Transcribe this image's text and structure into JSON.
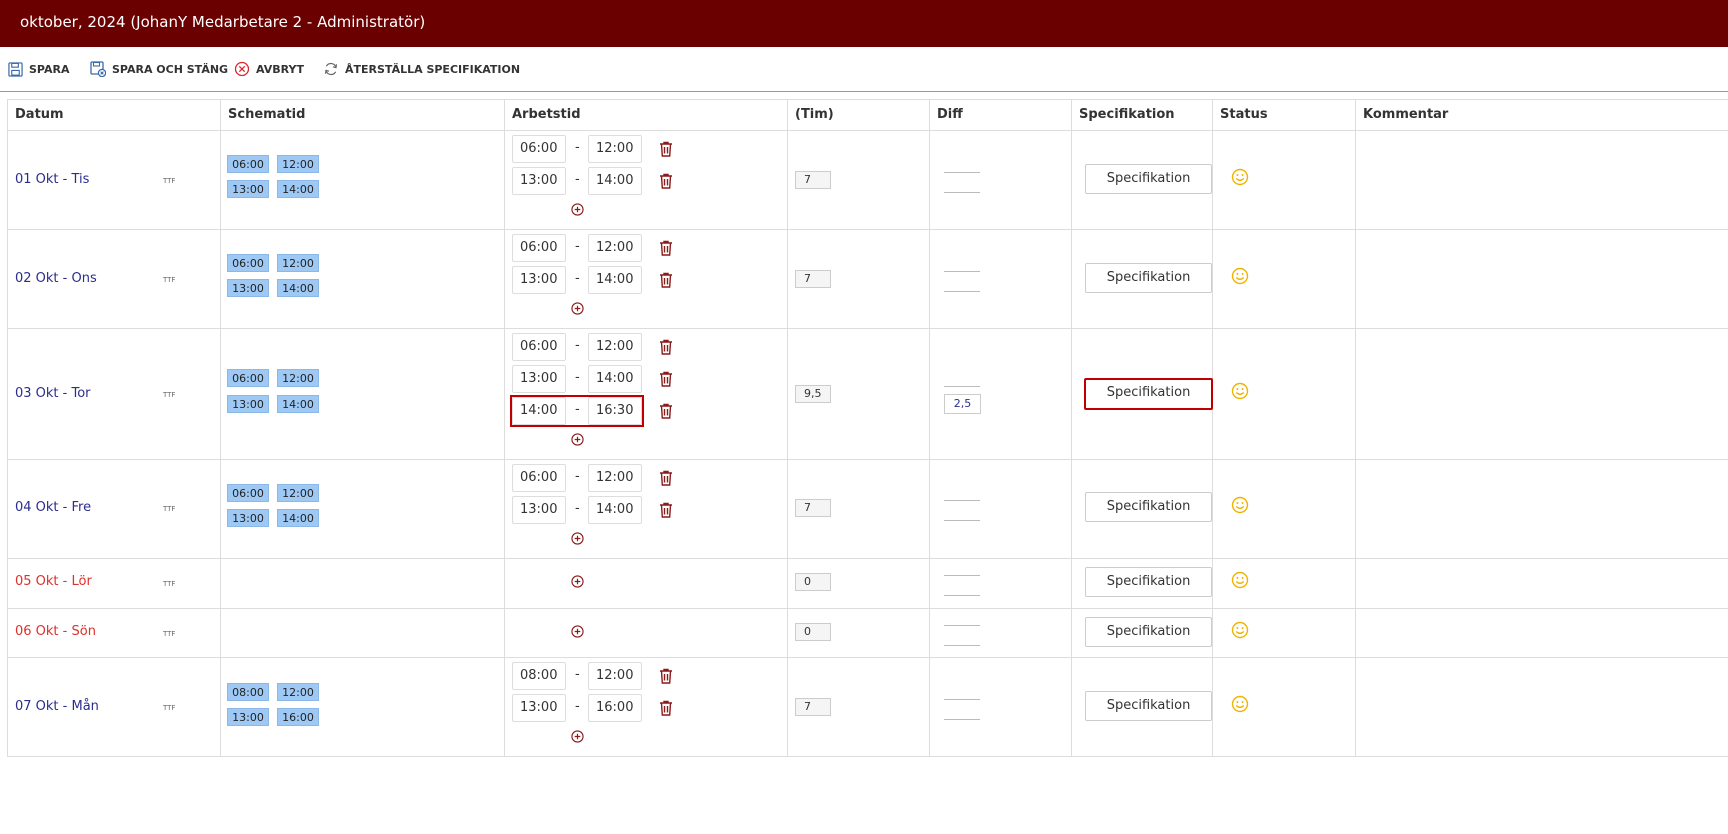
{
  "window": {
    "title": "oktober, 2024 (JohanY Medarbetare 2 - Administratör)"
  },
  "toolbar": {
    "save": "SPARA",
    "save_close": "SPARA OCH STÄNG",
    "cancel": "AVBRYT",
    "reset": "ÅTERSTÄLLA SPECIFIKATION"
  },
  "table": {
    "headers": {
      "datum": "Datum",
      "schematid": "Schematid",
      "arbetstid": "Arbetstid",
      "tim": "(Tim)",
      "diff": "Diff",
      "specifikation": "Specifikation",
      "status": "Status",
      "kommentar": "Kommentar"
    },
    "ttf": "TTF",
    "spec_label": "Specifikation",
    "rows": [
      {
        "date": "01 Okt - Tis",
        "chips": [
          "06:00",
          "12:00",
          "13:00",
          "14:00"
        ],
        "times": [
          [
            "06:00",
            "12:00"
          ],
          [
            "13:00",
            "14:00"
          ]
        ],
        "hours": "7",
        "diff": ""
      },
      {
        "date": "02 Okt - Ons",
        "chips": [
          "06:00",
          "12:00",
          "13:00",
          "14:00"
        ],
        "times": [
          [
            "06:00",
            "12:00"
          ],
          [
            "13:00",
            "14:00"
          ]
        ],
        "hours": "7",
        "diff": ""
      },
      {
        "date": "03 Okt - Tor",
        "chips": [
          "06:00",
          "12:00",
          "13:00",
          "14:00"
        ],
        "times": [
          [
            "06:00",
            "12:00"
          ],
          [
            "13:00",
            "14:00"
          ],
          [
            "14:00",
            "16:30"
          ]
        ],
        "hours": "9,5",
        "diff": "2,5"
      },
      {
        "date": "04 Okt - Fre",
        "chips": [
          "06:00",
          "12:00",
          "13:00",
          "14:00"
        ],
        "times": [
          [
            "06:00",
            "12:00"
          ],
          [
            "13:00",
            "14:00"
          ]
        ],
        "hours": "7",
        "diff": ""
      },
      {
        "date": "05 Okt - Lör",
        "chips": [],
        "times": [],
        "hours": "0",
        "diff": "",
        "weekend": true
      },
      {
        "date": "06 Okt - Sön",
        "chips": [],
        "times": [],
        "hours": "0",
        "diff": "",
        "weekend": true
      },
      {
        "date": "07 Okt - Mån",
        "chips": [
          "08:00",
          "12:00",
          "13:00",
          "16:00"
        ],
        "times": [
          [
            "08:00",
            "12:00"
          ],
          [
            "13:00",
            "16:00"
          ]
        ],
        "hours": "7",
        "diff": ""
      }
    ]
  },
  "colors": {
    "titlebar": "#6b0000",
    "chip": "#9ec9f5",
    "highlight": "#c00000",
    "weekend": "#e0302a",
    "date": "#2b2d8e",
    "smiley": "#f0b400"
  }
}
